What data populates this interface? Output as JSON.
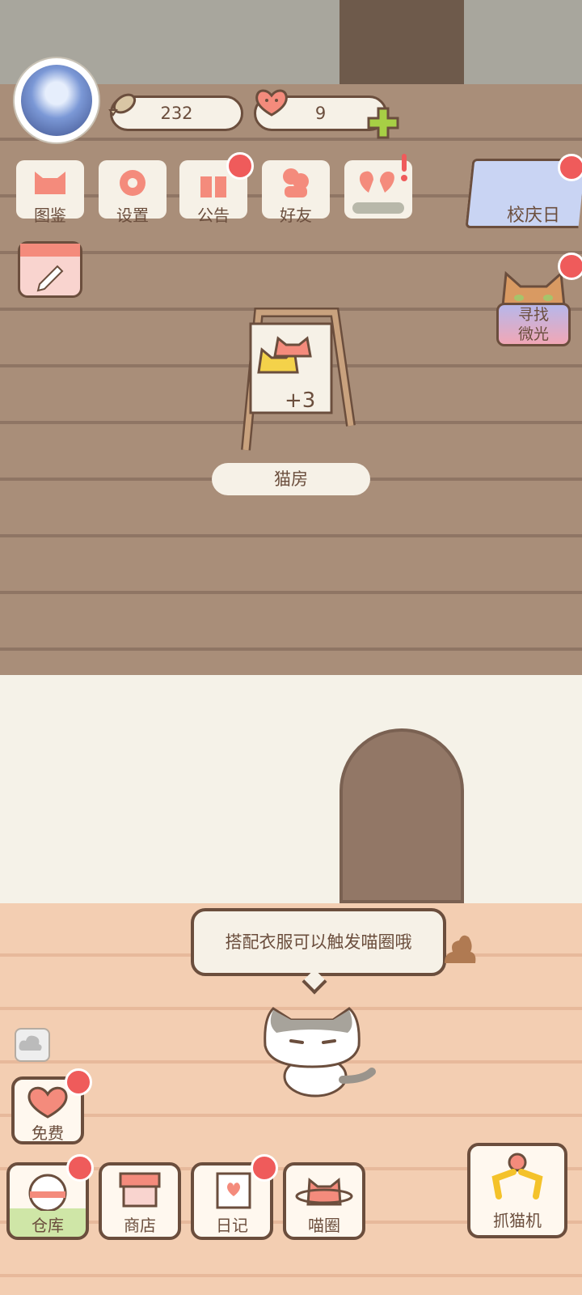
{
  "currency": {
    "fish": "232",
    "hearts": "9"
  },
  "top_menu": {
    "collection": "图鉴",
    "settings": "设置",
    "announcement": "公告",
    "friends": "好友"
  },
  "events": {
    "festival": "校庆日",
    "seek_light": "寻找\n微光"
  },
  "room": {
    "cat_house_label": "猫房",
    "cat_house_bonus": "+3"
  },
  "speech": {
    "text": "搭配衣服可以触发喵圈哦"
  },
  "bottom_menu": {
    "free": "免费",
    "warehouse": "仓库",
    "shop": "商店",
    "diary": "日记",
    "meow_circle": "喵圈",
    "claw_machine": "抓猫机"
  },
  "colors": {
    "accent_red": "#ef5b5b",
    "outline_brown": "#6b4e3d",
    "plus_green": "#a7cf45"
  }
}
